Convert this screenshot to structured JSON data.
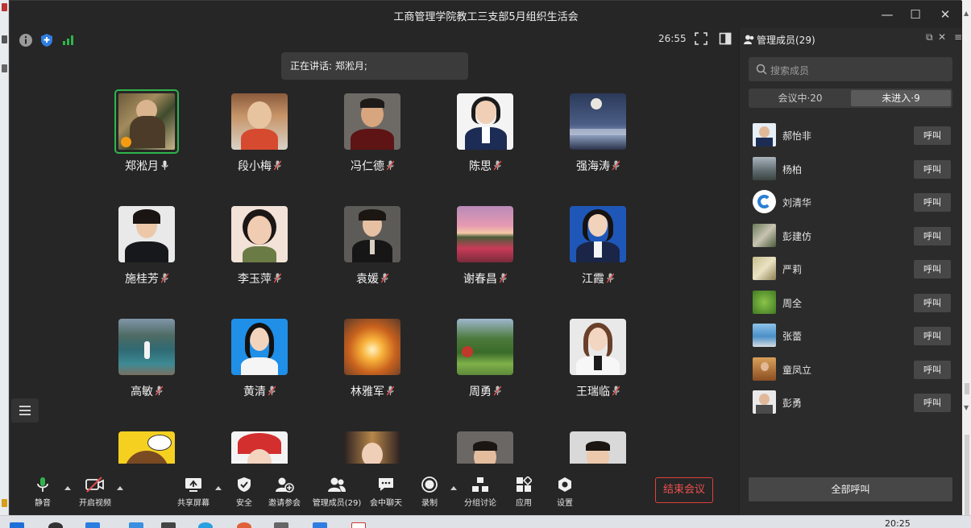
{
  "window": {
    "title": "工商管理学院教工三支部5月组织生活会",
    "controls": [
      "—",
      "☐",
      "✕"
    ]
  },
  "status": {
    "time": "26:55",
    "icons": [
      "info-icon",
      "shield-icon",
      "signal-icon",
      "fullscreen-icon",
      "layout-icon"
    ]
  },
  "speaking": {
    "text": "正在讲话: 郑淞月;"
  },
  "participants": [
    {
      "name": "郑淞月",
      "active": true,
      "mic": "on"
    },
    {
      "name": "段小梅",
      "mic": "muted"
    },
    {
      "name": "冯仁德",
      "mic": "muted"
    },
    {
      "name": "陈思",
      "mic": "muted"
    },
    {
      "name": "强海涛",
      "mic": "muted"
    },
    {
      "name": "施桂芳",
      "mic": "muted"
    },
    {
      "name": "李玉萍",
      "mic": "muted"
    },
    {
      "name": "袁媛",
      "mic": "muted"
    },
    {
      "name": "谢春昌",
      "mic": "muted"
    },
    {
      "name": "江霞",
      "mic": "muted"
    },
    {
      "name": "高敏",
      "mic": "muted"
    },
    {
      "name": "黄清",
      "mic": "muted"
    },
    {
      "name": "林雅军",
      "mic": "muted"
    },
    {
      "name": "周勇",
      "mic": "muted"
    },
    {
      "name": "王瑞临",
      "mic": "muted"
    },
    {
      "name": ""
    },
    {
      "name": ""
    },
    {
      "name": ""
    },
    {
      "name": ""
    },
    {
      "name": ""
    }
  ],
  "toolbar": {
    "mute": "静音",
    "video": "开启视频",
    "share": "共享屏幕",
    "security": "安全",
    "invite": "邀请参会",
    "manage": "管理成员(29)",
    "chat": "会中聊天",
    "record": "录制",
    "breakout": "分组讨论",
    "apps": "应用",
    "settings": "设置",
    "end": "结束会议"
  },
  "panel": {
    "title": "管理成员(29)",
    "search_placeholder": "搜索成员",
    "tab_in": "会议中·20",
    "tab_out": "未进入·9",
    "call_label": "呼叫",
    "call_all": "全部呼叫",
    "members": [
      "郝怡非",
      "杨柏",
      "刘清华",
      "彭建仿",
      "严莉",
      "周全",
      "张蕾",
      "童凤立",
      "彭勇"
    ]
  },
  "taskbar": {
    "clock": "20:25"
  },
  "colors": {
    "window_bg": "#262626",
    "active_border": "#2fb44a",
    "end_button": "#e0403c",
    "panel_bg": "#2b2b2b"
  }
}
